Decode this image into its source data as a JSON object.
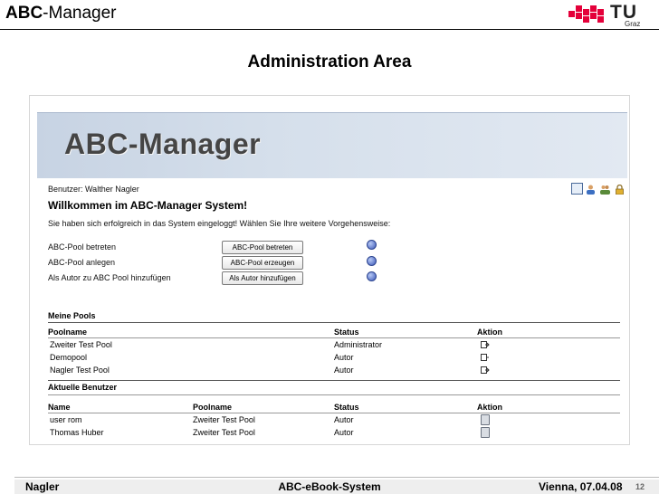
{
  "slide": {
    "title_bold": "ABC",
    "title_rest": "-Manager",
    "heading": "Administration Area",
    "logo": {
      "text": "TU",
      "subtext": "Graz"
    }
  },
  "app": {
    "banner_title": "ABC-Manager",
    "user_line": "Benutzer: Walther Nagler",
    "welcome": "Willkommen im ABC-Manager System!",
    "intro": "Sie haben sich erfolgreich in das System eingeloggt! Wählen Sie Ihre weitere Vorgehensweise:",
    "toolbar_icons": [
      "table-icon",
      "user-icon",
      "users-icon",
      "lock-icon"
    ],
    "actions": [
      {
        "label": "ABC-Pool betreten",
        "button": "ABC-Pool betreten"
      },
      {
        "label": "ABC-Pool anlegen",
        "button": "ABC-Pool erzeugen"
      },
      {
        "label": "Als Autor zu ABC Pool hinzufügen",
        "button": "Als Autor hinzufügen"
      }
    ],
    "my_pools": {
      "title": "Meine Pools",
      "columns": [
        "Poolname",
        "Status",
        "Aktion"
      ],
      "rows": [
        {
          "name": "Zweiter Test Pool",
          "status": "Administrator"
        },
        {
          "name": "Demopool",
          "status": "Autor"
        },
        {
          "name": "Nagler Test Pool",
          "status": "Autor"
        }
      ]
    },
    "active_users": {
      "title": "Aktuelle Benutzer",
      "columns": [
        "Name",
        "Poolname",
        "Status",
        "Aktion"
      ],
      "rows": [
        {
          "name": "user rom",
          "pool": "Zweiter Test Pool",
          "status": "Autor"
        },
        {
          "name": "Thomas Huber",
          "pool": "Zweiter Test Pool",
          "status": "Autor"
        }
      ]
    }
  },
  "footer": {
    "author": "Nagler",
    "title": "ABC-eBook-System",
    "place_date": "Vienna, 07.04.08",
    "page": "12"
  },
  "colors": {
    "accent_red": "#e4003a",
    "banner_blue": "#c7d3e3"
  }
}
